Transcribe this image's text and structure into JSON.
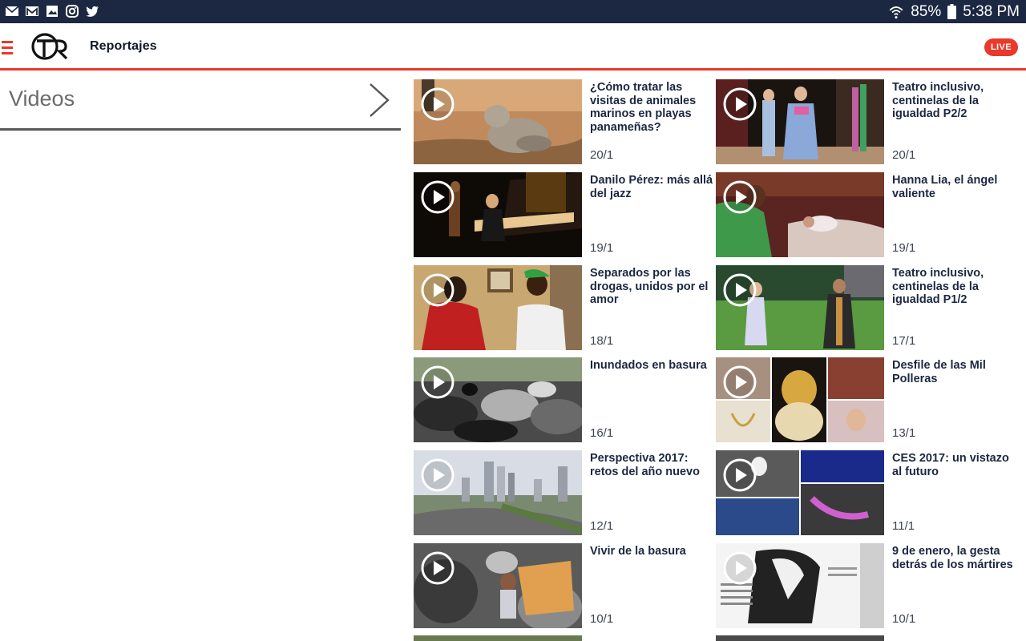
{
  "status_bar": {
    "battery": "85%",
    "time": "5:38 PM",
    "notification_icons": [
      "mail-icon",
      "gmail-icon",
      "image-icon",
      "instagram-icon",
      "twitter-icon"
    ]
  },
  "header": {
    "section_title": "Reportajes",
    "live_label": "LIVE"
  },
  "sidebar": {
    "title": "Videos"
  },
  "colors": {
    "brand_red": "#e8392b",
    "navy": "#1c2741"
  },
  "videos": [
    {
      "title": "¿Cómo tratar las visitas de animales marinos en playas panameñas?",
      "date": "20/1"
    },
    {
      "title": "Teatro inclusivo, centinelas de la igualdad P2/2",
      "date": "20/1"
    },
    {
      "title": "Danilo Pérez: más allá del jazz",
      "date": "19/1"
    },
    {
      "title": "Hanna Lia, el ángel valiente",
      "date": "19/1"
    },
    {
      "title": "Separados por las drogas, unidos por el amor",
      "date": "18/1"
    },
    {
      "title": "Teatro inclusivo, centinelas de la igualdad P1/2",
      "date": "17/1"
    },
    {
      "title": "Inundados en basura",
      "date": "16/1"
    },
    {
      "title": "Desfile de las Mil Polleras",
      "date": "13/1"
    },
    {
      "title": "Perspectiva 2017: retos del año nuevo",
      "date": "12/1"
    },
    {
      "title": "CES 2017: un vistazo al futuro",
      "date": "11/1"
    },
    {
      "title": "Vivir de la basura",
      "date": "10/1"
    },
    {
      "title": "9 de enero, la gesta detrás de los mártires",
      "date": "10/1"
    }
  ]
}
